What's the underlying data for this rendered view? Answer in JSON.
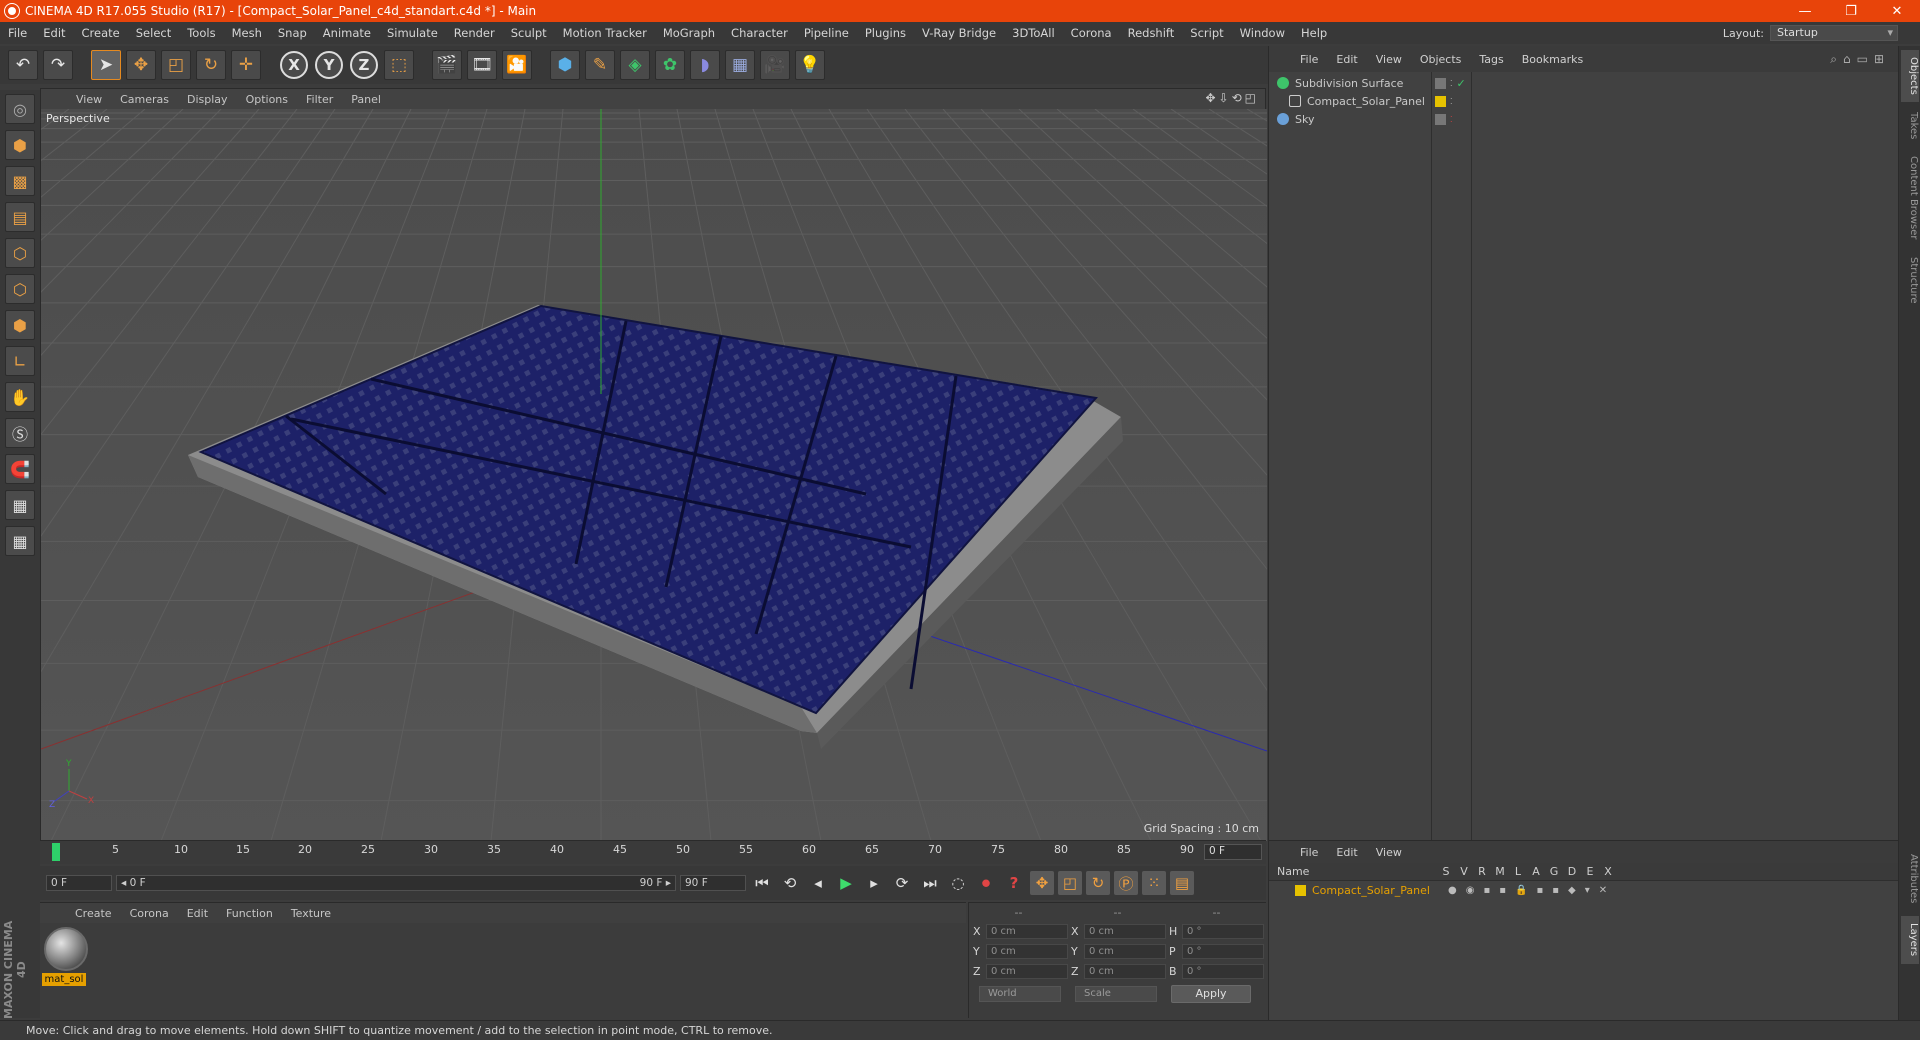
{
  "window": {
    "title": "CINEMA 4D R17.055 Studio (R17) - [Compact_Solar_Panel_c4d_standart.c4d *] - Main",
    "controls": [
      "—",
      "❐",
      "✕"
    ]
  },
  "menubar": {
    "items": [
      "File",
      "Edit",
      "Create",
      "Select",
      "Tools",
      "Mesh",
      "Snap",
      "Animate",
      "Simulate",
      "Render",
      "Sculpt",
      "Motion Tracker",
      "MoGraph",
      "Character",
      "Pipeline",
      "Plugins",
      "V-Ray Bridge",
      "3DToAll",
      "Corona",
      "Redshift",
      "Script",
      "Window",
      "Help"
    ],
    "layout_label": "Layout:",
    "layout_value": "Startup"
  },
  "viewport": {
    "menu": [
      "View",
      "Cameras",
      "Display",
      "Options",
      "Filter",
      "Panel"
    ],
    "label": "Perspective",
    "grid_spacing": "Grid Spacing : 10 cm",
    "axis_labels": {
      "y": "Y",
      "x": "X",
      "z": "Z"
    }
  },
  "timeline": {
    "ticks": [
      "0",
      "5",
      "10",
      "15",
      "20",
      "25",
      "30",
      "35",
      "40",
      "45",
      "50",
      "55",
      "60",
      "65",
      "70",
      "75",
      "80",
      "85",
      "90"
    ],
    "frame_field": "0 F"
  },
  "transport": {
    "start": "0 F",
    "range_left": "◂ 0 F",
    "range_right": "90 F ▸",
    "end": "90 F"
  },
  "material_manager": {
    "menu": [
      "Create",
      "Corona",
      "Edit",
      "Function",
      "Texture"
    ],
    "material_name": "mat_sol"
  },
  "coordinates": {
    "headers": [
      "--",
      "--",
      "--"
    ],
    "rows": [
      {
        "a": "X",
        "av": "0 cm",
        "b": "X",
        "bv": "0 cm",
        "c": "H",
        "cv": "0 °"
      },
      {
        "a": "Y",
        "av": "0 cm",
        "b": "Y",
        "bv": "0 cm",
        "c": "P",
        "cv": "0 °"
      },
      {
        "a": "Z",
        "av": "0 cm",
        "b": "Z",
        "bv": "0 cm",
        "c": "B",
        "cv": "0 °"
      }
    ],
    "mode1": "World",
    "mode2": "Scale",
    "apply": "Apply"
  },
  "object_manager": {
    "menu": [
      "File",
      "Edit",
      "View",
      "Objects",
      "Tags",
      "Bookmarks"
    ],
    "objects": [
      {
        "name": "Subdivision Surface",
        "color": "#3ec46a"
      },
      {
        "name": "Compact_Solar_Panel",
        "color": "#c8c8c8"
      },
      {
        "name": "Sky",
        "color": "#6aa0d8"
      }
    ]
  },
  "layer_manager": {
    "menu": [
      "File",
      "Edit",
      "View"
    ],
    "name_header": "Name",
    "col_headers": [
      "S",
      "V",
      "R",
      "M",
      "L",
      "A",
      "G",
      "D",
      "E",
      "X"
    ],
    "layer_name": "Compact_Solar_Panel"
  },
  "right_tabs": [
    "Objects",
    "Takes",
    "Content Browser",
    "Structure",
    "Attributes",
    "Layers"
  ],
  "status": "Move: Click and drag to move elements. Hold down SHIFT to quantize movement / add to the selection in point mode, CTRL to remove.",
  "brand": "MAXON CINEMA 4D",
  "colors": {
    "titlebar": "#e8440a",
    "accent": "#e6a000",
    "panel": "#1a1f66"
  }
}
